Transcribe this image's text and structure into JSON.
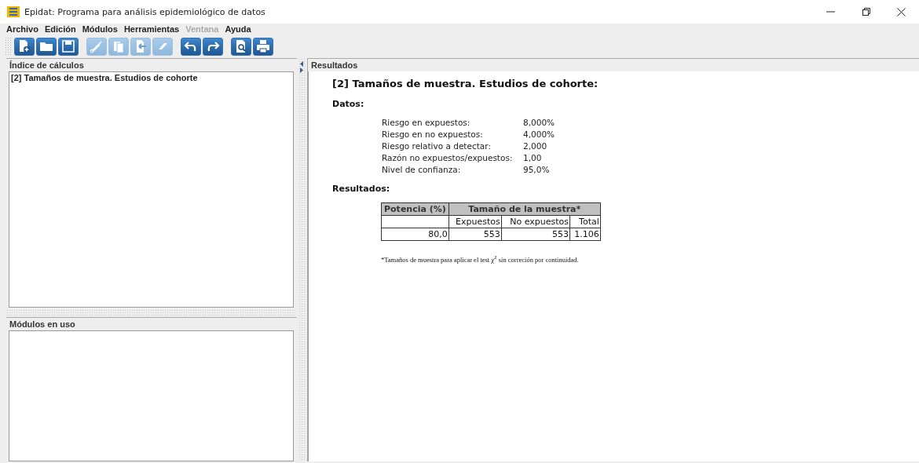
{
  "window": {
    "title": "Epidat: Programa para análisis epidemiológico de datos"
  },
  "menu": [
    {
      "label": "Archivo",
      "disabled": false
    },
    {
      "label": "Edición",
      "disabled": false
    },
    {
      "label": "Módulos",
      "disabled": false
    },
    {
      "label": "Herramientas",
      "disabled": false
    },
    {
      "label": "Ventana",
      "disabled": true
    },
    {
      "label": "Ayuda",
      "disabled": false
    }
  ],
  "toolbar": [
    [
      {
        "kind": "new",
        "disabled": false
      },
      {
        "kind": "open",
        "disabled": false
      },
      {
        "kind": "save",
        "disabled": false
      }
    ],
    [
      {
        "kind": "cut",
        "disabled": true
      },
      {
        "kind": "copy",
        "disabled": true
      },
      {
        "kind": "paste",
        "disabled": true
      },
      {
        "kind": "erase",
        "disabled": true
      }
    ],
    [
      {
        "kind": "undo",
        "disabled": false
      },
      {
        "kind": "redo",
        "disabled": false
      }
    ],
    [
      {
        "kind": "preview",
        "disabled": false
      },
      {
        "kind": "print",
        "disabled": false
      }
    ]
  ],
  "index_panel": {
    "title": "Índice de cálculos",
    "items": [
      {
        "label": "[2] Tamaños de muestra. Estudios de cohorte"
      }
    ]
  },
  "modules_panel": {
    "title": "Módulos en uso"
  },
  "results_panel": {
    "title": "Resultados",
    "heading": "[2] Tamaños de muestra. Estudios de cohorte:",
    "data_title": "Datos:",
    "data": [
      {
        "label": "Riesgo en expuestos:",
        "value": "8,000%"
      },
      {
        "label": "Riesgo en no expuestos:",
        "value": "4,000%"
      },
      {
        "label": "Riesgo relativo a detectar:",
        "value": "2,000"
      },
      {
        "label": "Razón no expuestos/expuestos:",
        "value": "1,00"
      },
      {
        "label": "Nivel de confianza:",
        "value": "95,0%"
      }
    ],
    "results_title": "Resultados:",
    "table": {
      "header": [
        "Potencia (%)",
        "Tamaño de la muestra*"
      ],
      "subheader": [
        "Expuestos",
        "No expuestos",
        "Total"
      ],
      "rows": [
        [
          "80,0",
          "553",
          "553",
          "1.106"
        ]
      ]
    },
    "footnote": "*Tamaños de muestra para aplicar el test χ$^{2}$ sin correción por continuidad."
  }
}
